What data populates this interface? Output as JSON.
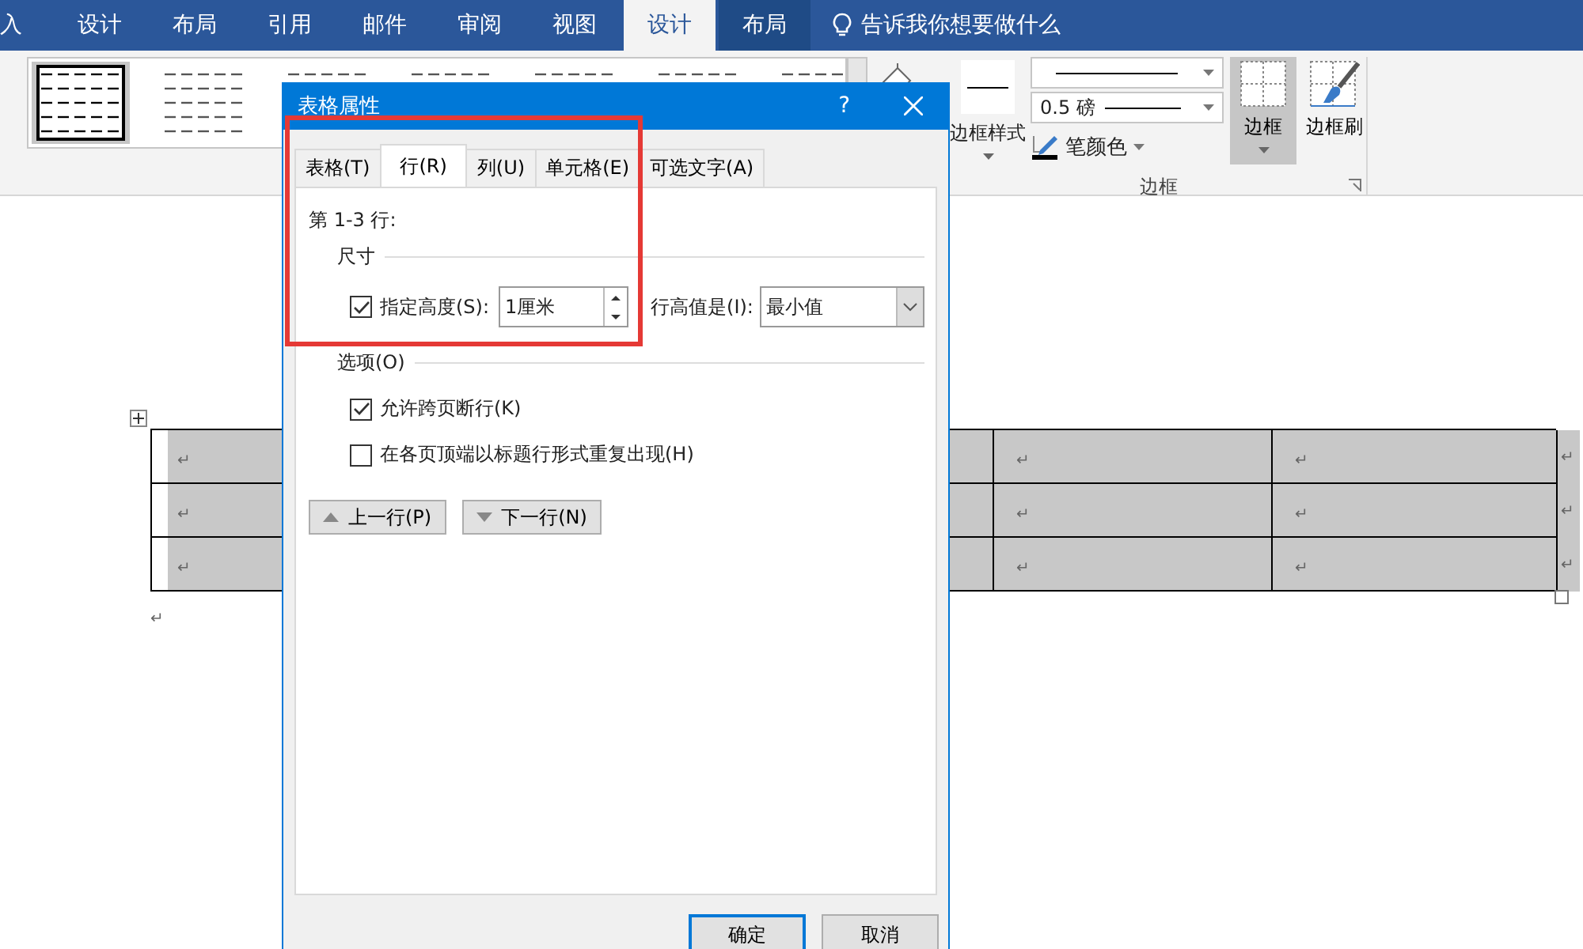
{
  "ribbon_tabs": [
    {
      "label": "入",
      "selected": false,
      "kind": "normal"
    },
    {
      "label": "设计",
      "selected": false,
      "kind": "normal"
    },
    {
      "label": "布局",
      "selected": false,
      "kind": "normal"
    },
    {
      "label": "引用",
      "selected": false,
      "kind": "normal"
    },
    {
      "label": "邮件",
      "selected": false,
      "kind": "normal"
    },
    {
      "label": "审阅",
      "selected": false,
      "kind": "normal"
    },
    {
      "label": "视图",
      "selected": false,
      "kind": "normal"
    },
    {
      "label": "设计",
      "selected": true,
      "kind": "contextual"
    },
    {
      "label": "布局",
      "selected": false,
      "kind": "contextual"
    }
  ],
  "tell_me": "告诉我你想要做什么",
  "table_styles": [
    {
      "selected": true
    },
    {
      "selected": false
    },
    {
      "selected": false
    },
    {
      "selected": false
    },
    {
      "selected": false
    },
    {
      "selected": false
    },
    {
      "selected": false
    }
  ],
  "borders_group": {
    "label": "边框",
    "border_styles": "边框样式",
    "pen_weight": "0.5 磅",
    "pen_color": "笔颜色",
    "borders_button": {
      "label": "边框",
      "selected": true
    },
    "border_painter": "边框刷"
  },
  "table": {
    "rows": [
      {
        "cells": [
          "↵",
          "↵",
          "↵"
        ],
        "end_mark": "↵"
      },
      {
        "cells": [
          "↵",
          "↵",
          "↵"
        ],
        "end_mark": "↵"
      },
      {
        "cells": [
          "↵",
          "↵",
          "↵"
        ],
        "end_mark": "↵"
      }
    ]
  },
  "paragraph_mark": "↵",
  "dialog": {
    "title": "表格属性",
    "help": "?",
    "tabs": [
      {
        "label": "表格(T)",
        "selected": false
      },
      {
        "label": "行(R)",
        "selected": true
      },
      {
        "label": "列(U)",
        "selected": false
      },
      {
        "label": "单元格(E)",
        "selected": false
      },
      {
        "label": "可选文字(A)",
        "selected": false
      }
    ],
    "rows_label": "第 1-3 行:",
    "size_section": "尺寸",
    "specify_height": {
      "label": "指定高度(S):",
      "checked": true
    },
    "height_value": "1厘米",
    "row_height_label": "行高值是(I):",
    "row_height_mode": "最小值",
    "options_section": "选项(O)",
    "options": [
      {
        "label": "允许跨页断行(K)",
        "checked": true
      },
      {
        "label": "在各页顶端以标题行形式重复出现(H)",
        "checked": false
      }
    ],
    "nav_buttons": [
      {
        "label": "上一行(P)",
        "kind": "up"
      },
      {
        "label": "下一行(N)",
        "kind": "down"
      }
    ],
    "buttons": [
      {
        "label": "确定",
        "default": true
      },
      {
        "label": "取消",
        "default": false
      }
    ]
  }
}
